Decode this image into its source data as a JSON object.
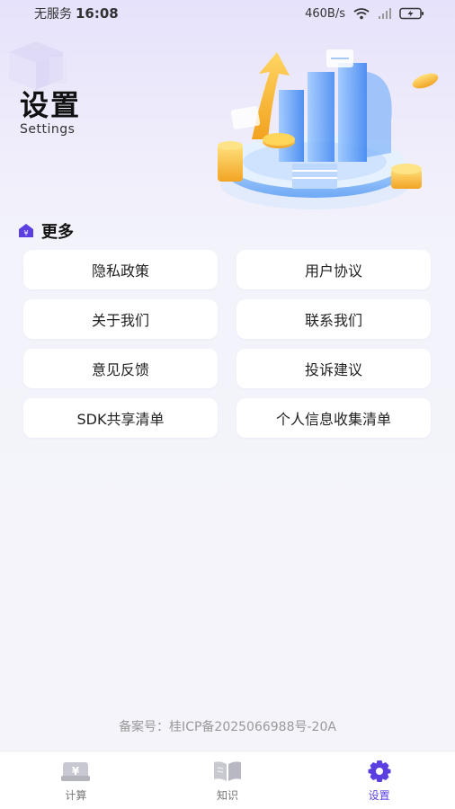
{
  "status_bar": {
    "carrier": "无服务",
    "time": "16:08",
    "network_speed": "460B/s",
    "icons": [
      "wifi-icon",
      "signal-icon",
      "battery-icon"
    ]
  },
  "header": {
    "title": "设置",
    "subtitle": "Settings"
  },
  "section": {
    "title": "更多",
    "icon": "yen-house-icon",
    "items": [
      {
        "label": "隐私政策"
      },
      {
        "label": "用户协议"
      },
      {
        "label": "关于我们"
      },
      {
        "label": "联系我们"
      },
      {
        "label": "意见反馈"
      },
      {
        "label": "投诉建议"
      },
      {
        "label": "SDK共享清单"
      },
      {
        "label": "个人信息收集清单"
      }
    ]
  },
  "footer": {
    "record": "备案号：桂ICP备2025066988号-20A"
  },
  "tabbar": {
    "tabs": [
      {
        "label": "计算",
        "icon": "calculator-icon",
        "active": false
      },
      {
        "label": "知识",
        "icon": "book-icon",
        "active": false
      },
      {
        "label": "设置",
        "icon": "gear-icon",
        "active": true
      }
    ]
  },
  "colors": {
    "accent": "#5b3fe0",
    "inactive_icon": "#c8c8d0",
    "background": "#f4f4fa",
    "card": "#ffffff"
  }
}
